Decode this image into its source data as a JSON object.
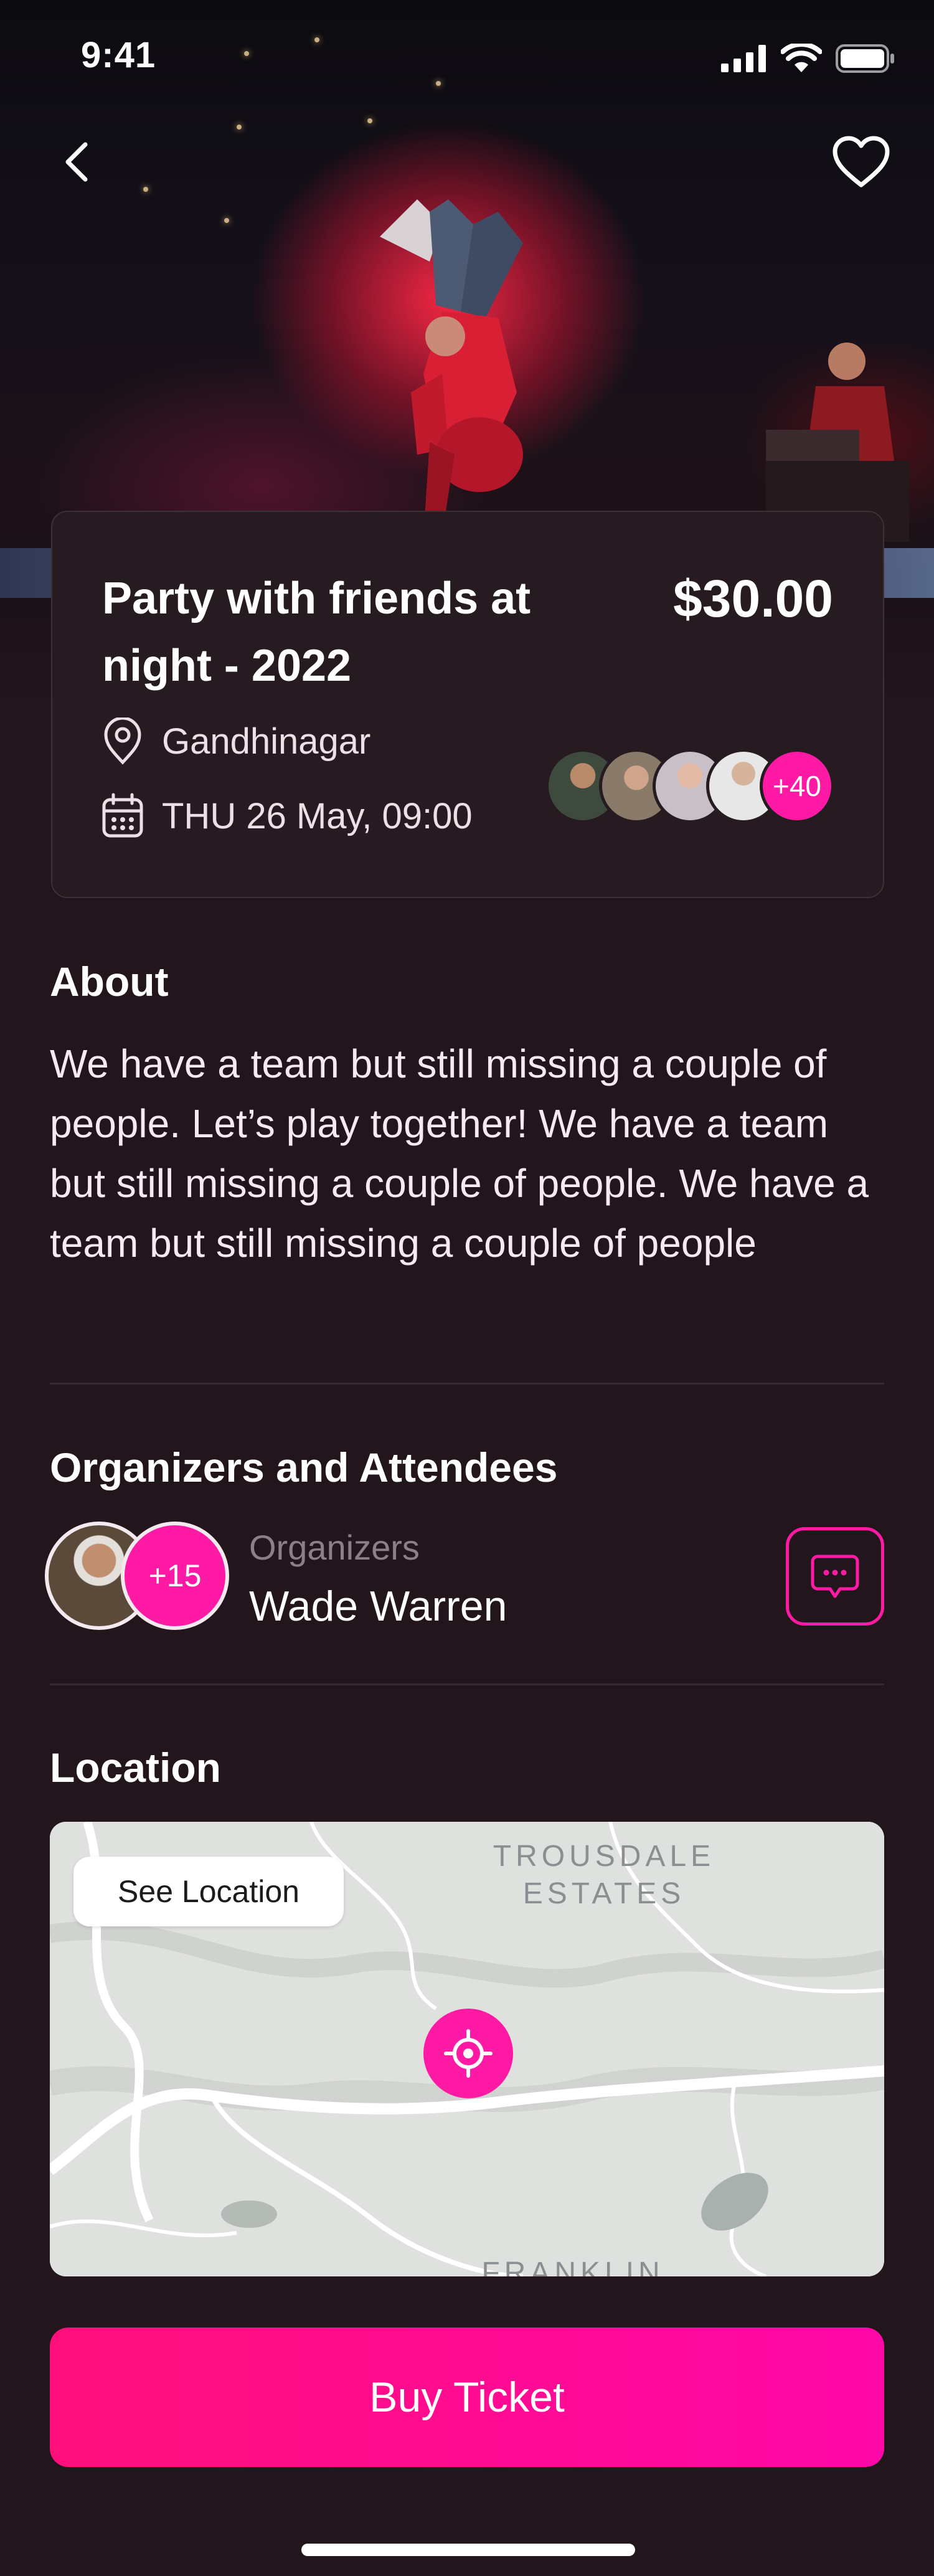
{
  "status_bar": {
    "time": "9:41"
  },
  "event": {
    "title": "Party with friends at night - 2022",
    "price": "$30.00",
    "location": "Gandhinagar",
    "datetime": "THU 26 May, 09:00",
    "attendees_more": "+40"
  },
  "about": {
    "title": "About",
    "text": "We have a team but still missing a couple of people. Let’s play together! We have a team but still missing a couple of people. We have a team but still missing a couple of people"
  },
  "organizers": {
    "title": "Organizers and Attendees",
    "count_more": "+15",
    "label": "Organizers",
    "name": "Wade Warren"
  },
  "location": {
    "title": "Location",
    "see_location": "See Location",
    "map_label_1": "TROUSDALE\nESTATES",
    "map_label_2": "FRANKLIN"
  },
  "cta": {
    "buy_label": "Buy Ticket"
  },
  "colors": {
    "accent": "#ff1aa6",
    "background": "#23151c",
    "card": "#261b20"
  },
  "icons": [
    "back-chevron-icon",
    "heart-icon",
    "location-pin-icon",
    "calendar-icon",
    "chat-icon",
    "target-icon",
    "signal-icon",
    "wifi-icon",
    "battery-icon"
  ]
}
